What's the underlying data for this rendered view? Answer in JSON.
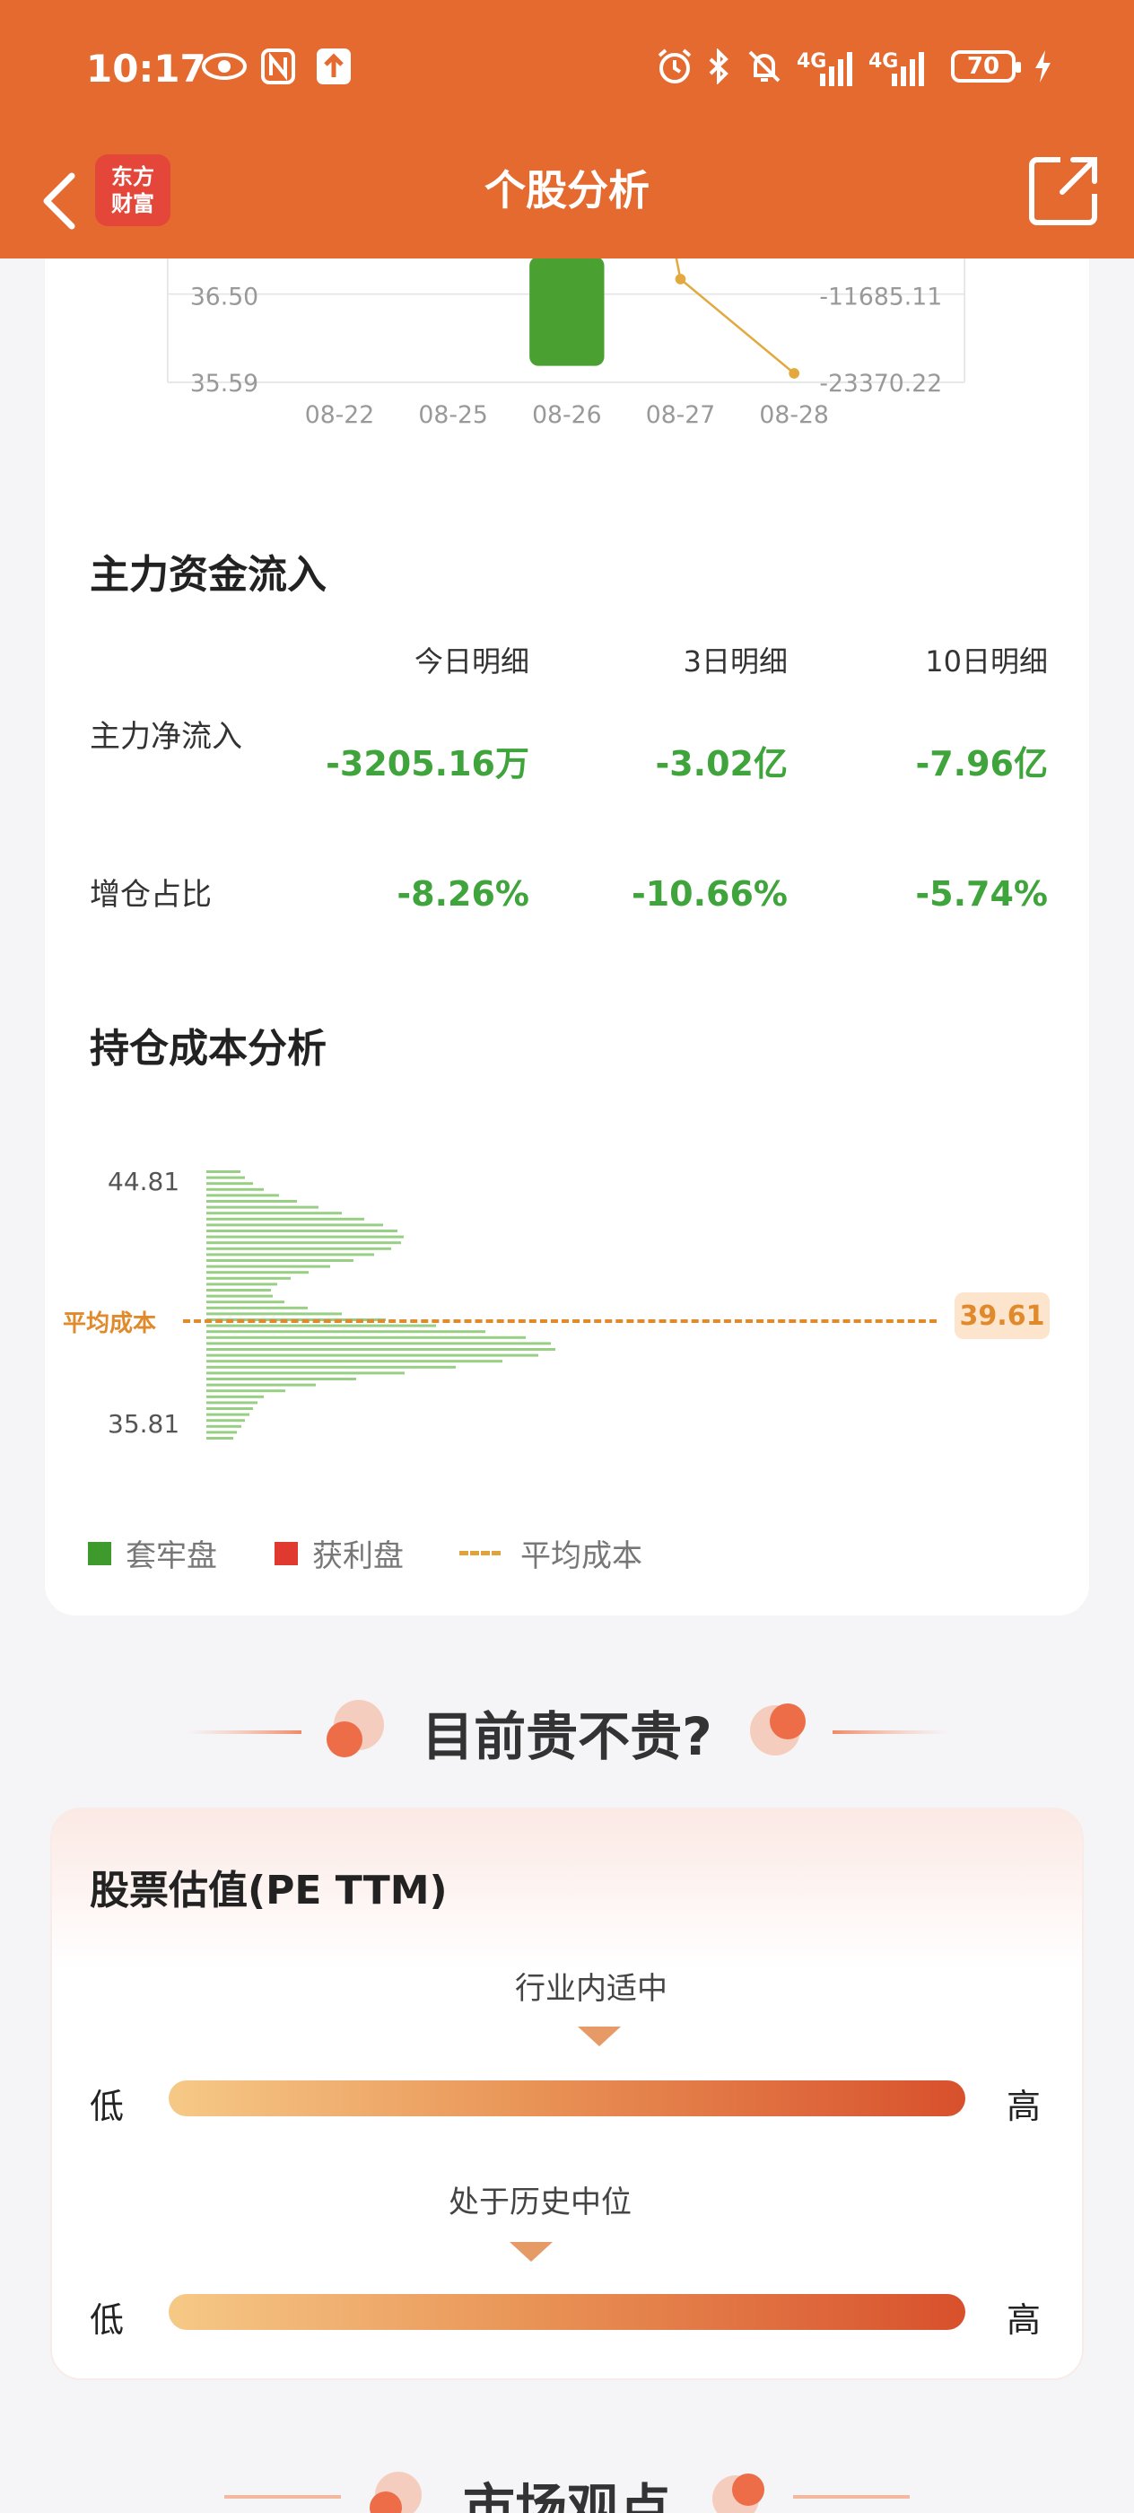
{
  "status_bar": {
    "time": "10:17",
    "battery": "70",
    "net1": "4G",
    "net2": "4G"
  },
  "header": {
    "title": "个股分析",
    "logo_line1": "东方",
    "logo_line2": "财富"
  },
  "trend_chart": {
    "left_ticks": [
      "36.50",
      "35.59"
    ],
    "right_ticks": [
      "-11685.11",
      "-23370.22"
    ],
    "x_labels": [
      "08-22",
      "08-25",
      "08-26",
      "08-27",
      "08-28"
    ],
    "bar_color": "#4aa132",
    "line_color": "#e3a93f"
  },
  "fund_flow": {
    "title": "主力资金流入",
    "columns": [
      "今日明细",
      "3日明细",
      "10日明细"
    ],
    "rows": [
      {
        "label": "主力净流入",
        "values": [
          "-3205.16万",
          "-3.02亿",
          "-7.96亿"
        ]
      },
      {
        "label": "增仓占比",
        "values": [
          "-8.26%",
          "-10.66%",
          "-5.74%"
        ]
      }
    ],
    "value_color": "#3fa43b"
  },
  "cost_analysis": {
    "title": "持仓成本分析",
    "y_top": "44.81",
    "y_bottom": "35.81",
    "avg_label": "平均成本",
    "avg_value": "39.61",
    "legend": [
      {
        "label": "套牢盘",
        "color": "#3f9a2e"
      },
      {
        "label": "获利盘",
        "color": "#e03a30"
      },
      {
        "label": "平均成本",
        "color": "#e0a23c"
      }
    ]
  },
  "valuation_section": {
    "heading": "目前贵不贵?",
    "card_title": "股票估值(PE TTM)",
    "gauges": [
      {
        "caption": "行业内适中",
        "low": "低",
        "high": "高"
      },
      {
        "caption": "处于历史中位",
        "low": "低",
        "high": "高"
      }
    ]
  },
  "next_section": {
    "heading": "市场观点"
  }
}
